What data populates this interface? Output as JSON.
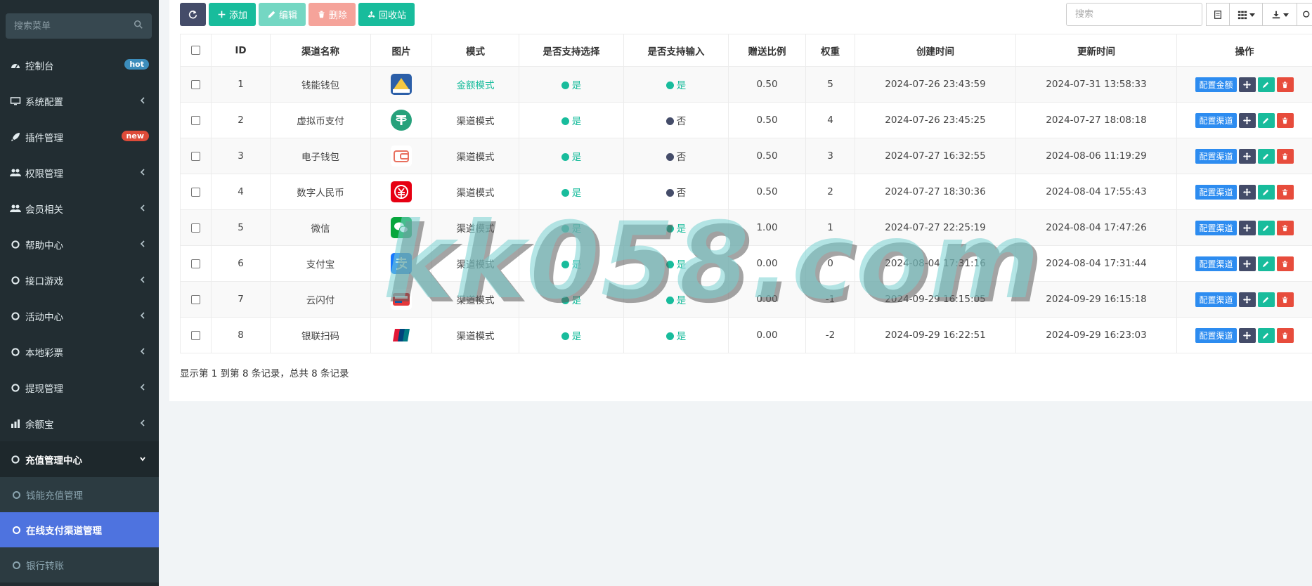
{
  "sidebar": {
    "search_placeholder": "搜索菜单",
    "items": [
      {
        "label": "控制台",
        "icon": "dashboard-icon",
        "badge": "hot",
        "badge_color": "#3c8dbc"
      },
      {
        "label": "系统配置",
        "icon": "monitor-icon"
      },
      {
        "label": "插件管理",
        "icon": "rocket-icon",
        "badge": "new",
        "badge_color": "#dd4b39"
      },
      {
        "label": "权限管理",
        "icon": "group-icon"
      },
      {
        "label": "会员相关",
        "icon": "group-icon"
      },
      {
        "label": "帮助中心",
        "icon": "circle-icon"
      },
      {
        "label": "接口游戏",
        "icon": "circle-icon"
      },
      {
        "label": "活动中心",
        "icon": "circle-icon"
      },
      {
        "label": "本地彩票",
        "icon": "circle-icon"
      },
      {
        "label": "提现管理",
        "icon": "circle-icon"
      },
      {
        "label": "余额宝",
        "icon": "stats-icon"
      },
      {
        "label": "充值管理中心",
        "icon": "circle-icon",
        "open": true
      }
    ],
    "submenu": [
      {
        "label": "钱能充值管理"
      },
      {
        "label": "在线支付渠道管理",
        "active": true
      },
      {
        "label": "银行转账"
      }
    ]
  },
  "toolbar": {
    "add_label": "添加",
    "edit_label": "编辑",
    "delete_label": "删除",
    "recycle_label": "回收站",
    "search_placeholder": "搜索"
  },
  "table": {
    "columns": [
      "ID",
      "渠道名称",
      "图片",
      "模式",
      "是否支持选择",
      "是否支持输入",
      "赠送比例",
      "权重",
      "创建时间",
      "更新时间",
      "操作"
    ],
    "rows": [
      {
        "id": "1",
        "name": "钱能钱包",
        "icon": "qianneng-logo-icon",
        "mode": "金额模式",
        "select": "是",
        "input": "是",
        "ratio": "0.50",
        "weight": "5",
        "created": "2024-07-26 23:43:59",
        "updated": "2024-07-31 13:58:33",
        "op": "配置金额"
      },
      {
        "id": "2",
        "name": "虚拟币支付",
        "icon": "tether-icon",
        "mode": "渠道模式",
        "select": "是",
        "input": "否",
        "ratio": "0.50",
        "weight": "4",
        "created": "2024-07-26 23:45:25",
        "updated": "2024-07-27 18:08:18",
        "op": "配置渠道"
      },
      {
        "id": "3",
        "name": "电子钱包",
        "icon": "wallet-icon",
        "mode": "渠道模式",
        "select": "是",
        "input": "否",
        "ratio": "0.50",
        "weight": "3",
        "created": "2024-07-27 16:32:55",
        "updated": "2024-08-06 11:19:29",
        "op": "配置渠道"
      },
      {
        "id": "4",
        "name": "数字人民币",
        "icon": "ecny-icon",
        "mode": "渠道模式",
        "select": "是",
        "input": "否",
        "ratio": "0.50",
        "weight": "2",
        "created": "2024-07-27 18:30:36",
        "updated": "2024-08-04 17:55:43",
        "op": "配置渠道"
      },
      {
        "id": "5",
        "name": "微信",
        "icon": "wechat-icon",
        "mode": "渠道模式",
        "select": "是",
        "input": "是",
        "ratio": "1.00",
        "weight": "1",
        "created": "2024-07-27 22:25:19",
        "updated": "2024-08-04 17:47:26",
        "op": "配置渠道"
      },
      {
        "id": "6",
        "name": "支付宝",
        "icon": "alipay-icon",
        "mode": "渠道模式",
        "select": "是",
        "input": "是",
        "ratio": "0.00",
        "weight": "0",
        "created": "2024-08-04 17:31:16",
        "updated": "2024-08-04 17:31:44",
        "op": "配置渠道"
      },
      {
        "id": "7",
        "name": "云闪付",
        "icon": "quickpass-icon",
        "mode": "渠道模式",
        "select": "是",
        "input": "是",
        "ratio": "0.00",
        "weight": "-1",
        "created": "2024-09-29 16:15:05",
        "updated": "2024-09-29 16:15:18",
        "op": "配置渠道"
      },
      {
        "id": "8",
        "name": "银联扫码",
        "icon": "unionpay-icon",
        "mode": "渠道模式",
        "select": "是",
        "input": "是",
        "ratio": "0.00",
        "weight": "-2",
        "created": "2024-09-29 16:22:51",
        "updated": "2024-09-29 16:23:03",
        "op": "配置渠道"
      }
    ]
  },
  "footer": {
    "summary": "显示第 1 到第 8 条记录，总共 8 条记录"
  },
  "watermark": "kk058.com",
  "colors": {
    "green": "#18bc9c",
    "dark": "#444c69",
    "red": "#e74c3c",
    "blue": "#2d8cf0",
    "active_menu": "#4e73df"
  }
}
